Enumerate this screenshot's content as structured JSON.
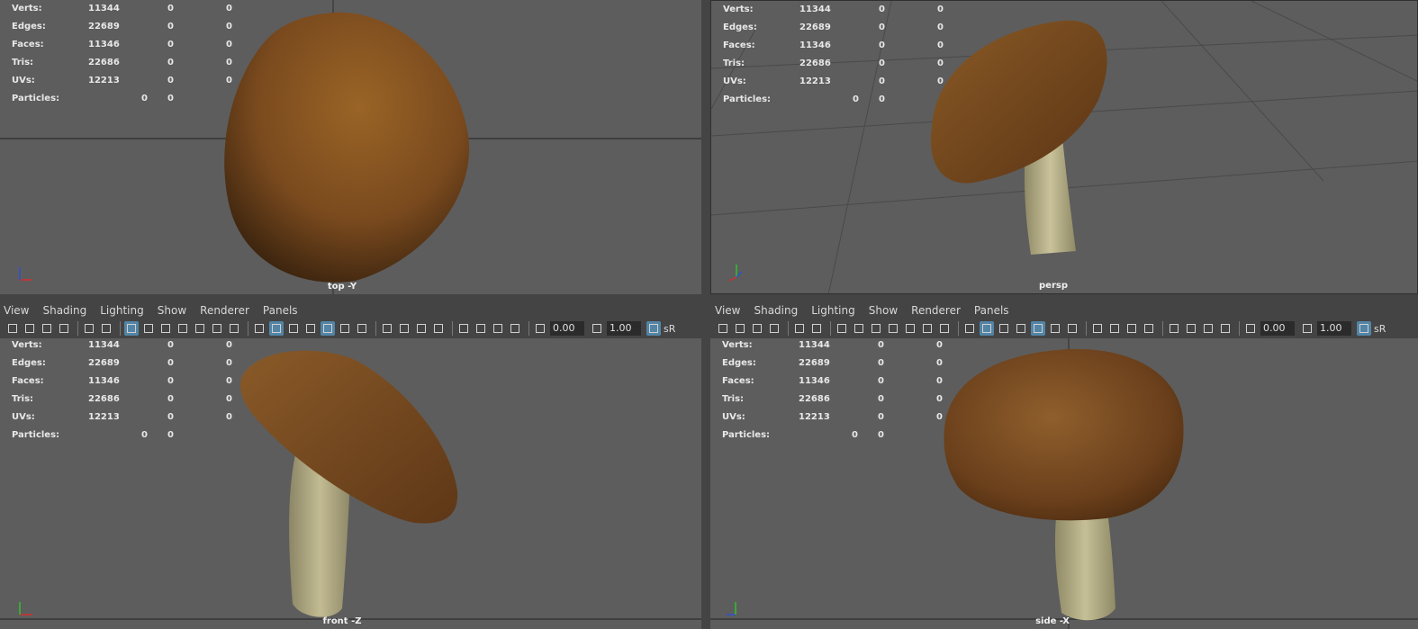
{
  "stats_labels": [
    "Verts:",
    "Edges:",
    "Faces:",
    "Tris:",
    "UVs:",
    "Particles:"
  ],
  "stats_rows": [
    {
      "label": "Verts:",
      "v1": "11344",
      "v2": "0",
      "v3": "0"
    },
    {
      "label": "Edges:",
      "v1": "22689",
      "v2": "0",
      "v3": "0"
    },
    {
      "label": "Faces:",
      "v1": "11346",
      "v2": "0",
      "v3": "0"
    },
    {
      "label": "Tris:",
      "v1": "22686",
      "v2": "0",
      "v3": "0"
    },
    {
      "label": "UVs:",
      "v1": "12213",
      "v2": "0",
      "v3": "0"
    }
  ],
  "particles": {
    "label": "Particles:",
    "v1": "0",
    "v2": "0"
  },
  "viewports": {
    "top": {
      "camera": "top -Y"
    },
    "persp": {
      "camera": "persp"
    },
    "front": {
      "camera": "front -Z"
    },
    "side": {
      "camera": "side -X"
    }
  },
  "menu": [
    "View",
    "Shading",
    "Lighting",
    "Show",
    "Renderer",
    "Panels"
  ],
  "toolbar": {
    "exposure": "0.00",
    "gamma": "1.00",
    "colorspace": "sR"
  },
  "colors": {
    "viewport_bg": "#5d5d5d",
    "ui_bg": "#444444",
    "active_icon": "#5285a6",
    "cap": "#7a4a22",
    "stem": "#bdb48a"
  },
  "icons": [
    "camera-icon",
    "grid-icon",
    "film-gate-icon",
    "wireframe-icon",
    "smooth-shade-icon",
    "textured-icon",
    "lights-icon",
    "isolate-icon",
    "xray-icon",
    "exposure-icon",
    "gamma-icon",
    "colorspace-icon"
  ]
}
